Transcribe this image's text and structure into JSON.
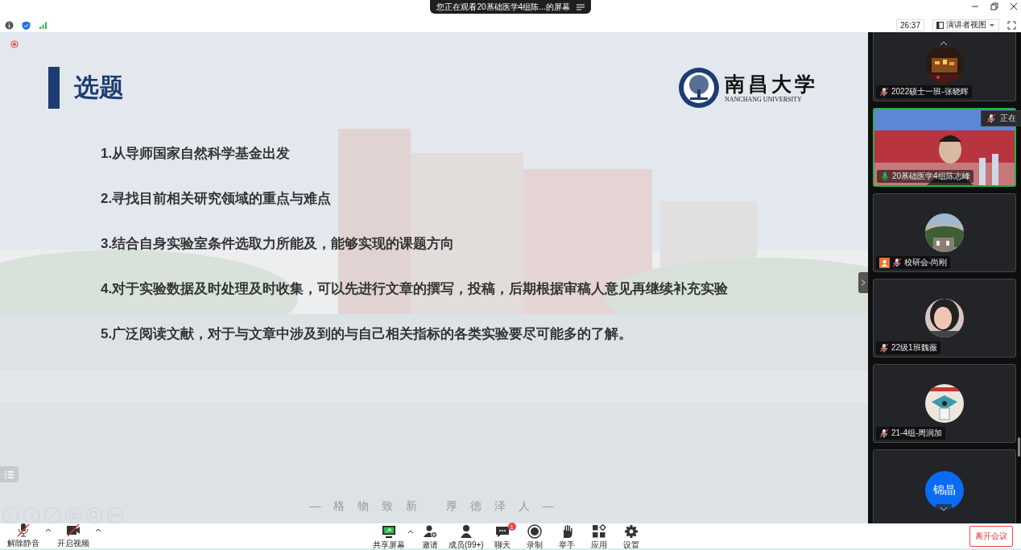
{
  "title_bar": {
    "title": "您正在观看20基础医学4组陈...的屏幕"
  },
  "info_bar": {
    "timer": "26:37",
    "view_button": "演讲者视图"
  },
  "slide": {
    "title": "选题",
    "logo_name": "南昌大学",
    "logo_name_en": "NANCHANG UNIVERSITY",
    "points": [
      "1.从导师国家自然科学基金出发",
      "2.寻找目前相关研究领域的重点与难点",
      "3.结合自身实验室条件选取力所能及，能够实现的课题方向",
      "4.对于实验数据及时处理及时收集，可以先进行文章的撰写，投稿，后期根据审稿人意见再继续补充实验",
      "5.广泛阅读文献，对于与文章中涉及到的与自己相关指标的各类实验要尽可能多的了解。"
    ],
    "motto": "— 格 物 致 新 　厚 德 泽 人 —"
  },
  "participants": [
    {
      "kind": "avatar",
      "name": "2022硕士一班-张晓晖",
      "muted": true,
      "selected": false,
      "host": false
    },
    {
      "kind": "video",
      "name": "20基础医学4组陈志峰",
      "muted": false,
      "selected": true,
      "host": false
    },
    {
      "kind": "avatar",
      "name": "校研会-尚刚",
      "muted": true,
      "selected": false,
      "host": true
    },
    {
      "kind": "avatar",
      "name": "22级1班魏薇",
      "muted": true,
      "selected": false,
      "host": false
    },
    {
      "kind": "avatar",
      "name": "21-4组-周润加",
      "muted": true,
      "selected": false,
      "host": false
    },
    {
      "kind": "initials",
      "initials": "锦晶",
      "selected": false
    }
  ],
  "speaking_popup": {
    "text": "正在"
  },
  "toolbar": {
    "left": [
      {
        "kind": "mic",
        "label": "解除静音",
        "off": true
      },
      {
        "kind": "camera",
        "label": "开启视频",
        "off": true
      }
    ],
    "center": [
      {
        "kind": "share",
        "label": "共享屏幕"
      },
      {
        "kind": "invite",
        "label": "邀请"
      },
      {
        "kind": "members",
        "label": "成员(99+)"
      },
      {
        "kind": "chat",
        "label": "聊天",
        "badge": "1"
      },
      {
        "kind": "record",
        "label": "录制"
      },
      {
        "kind": "hand",
        "label": "举手"
      },
      {
        "kind": "apps",
        "label": "应用"
      },
      {
        "kind": "settings",
        "label": "设置"
      }
    ],
    "leave_button": "离开会议"
  }
}
